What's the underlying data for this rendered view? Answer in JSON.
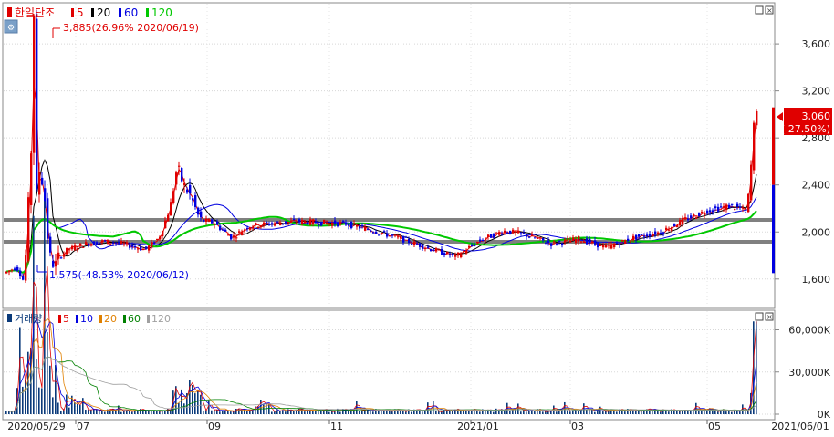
{
  "price_panel": {
    "legend": {
      "name": "한일단조",
      "ma": [
        {
          "label": "5",
          "color": "#e00000"
        },
        {
          "label": "20",
          "color": "#000000"
        },
        {
          "label": "60",
          "color": "#0000e0"
        },
        {
          "label": "120",
          "color": "#00c800"
        }
      ]
    },
    "high_annotation": "3,885(26.96% 2020/06/19)",
    "low_annotation": "1,575(-48.53% 2020/06/12)",
    "current_price": "3,060",
    "current_change": "( 27.50%)",
    "y_ticks": [
      "3,600",
      "3,200",
      "2,800",
      "2,400",
      "2,000",
      "1,600"
    ],
    "colors": {
      "up": "#e00000",
      "down": "#0000e0",
      "support": "#808080"
    }
  },
  "volume_panel": {
    "legend": {
      "name": "거래량",
      "ma": [
        {
          "label": "5",
          "color": "#e00000"
        },
        {
          "label": "10",
          "color": "#0000e0"
        },
        {
          "label": "20",
          "color": "#e08000"
        },
        {
          "label": "60",
          "color": "#008000"
        },
        {
          "label": "120",
          "color": "#a0a0a0"
        }
      ]
    },
    "y_ticks": [
      "60,000K",
      "30,000K",
      "0K"
    ]
  },
  "x_axis": {
    "labels": [
      "2020/05/29",
      "07",
      "09",
      "11",
      "2021/01",
      "03",
      "05",
      "2021/06/01"
    ]
  },
  "chart_data": [
    {
      "type": "candlestick",
      "title": "한일단조",
      "y_ticks": [
        1600,
        2000,
        2400,
        2800,
        3200,
        3600
      ],
      "ylim": [
        1350,
        3950
      ],
      "support_lines": [
        1820,
        2030
      ],
      "segments": [
        {
          "period": "2020/05/29",
          "close": 1650
        },
        {
          "period": "2020/06/12",
          "low": 1575
        },
        {
          "period": "2020/06/19",
          "high": 3885
        },
        {
          "period": "2020/07",
          "close": 1850
        },
        {
          "period": "2020/09",
          "close": 2500
        },
        {
          "period": "2020/11",
          "close": 2050
        },
        {
          "period": "2021/01",
          "close": 1900
        },
        {
          "period": "2021/03",
          "close": 1900
        },
        {
          "period": "2021/05",
          "close": 2200
        },
        {
          "period": "2021/06/01",
          "close": 3060
        }
      ],
      "moving_averages": [
        "5",
        "20",
        "60",
        "120"
      ]
    },
    {
      "type": "bar",
      "title": "거래량",
      "y_ticks_K": [
        0,
        30000,
        60000
      ],
      "ylim_K": [
        0,
        72000
      ],
      "peaks_K": [
        {
          "period": "2020/06",
          "value": 65000
        },
        {
          "period": "2020/09",
          "value": 30000
        },
        {
          "period": "2021/06/01",
          "value": 66000
        }
      ],
      "moving_averages": [
        "5",
        "10",
        "20",
        "60",
        "120"
      ]
    }
  ]
}
